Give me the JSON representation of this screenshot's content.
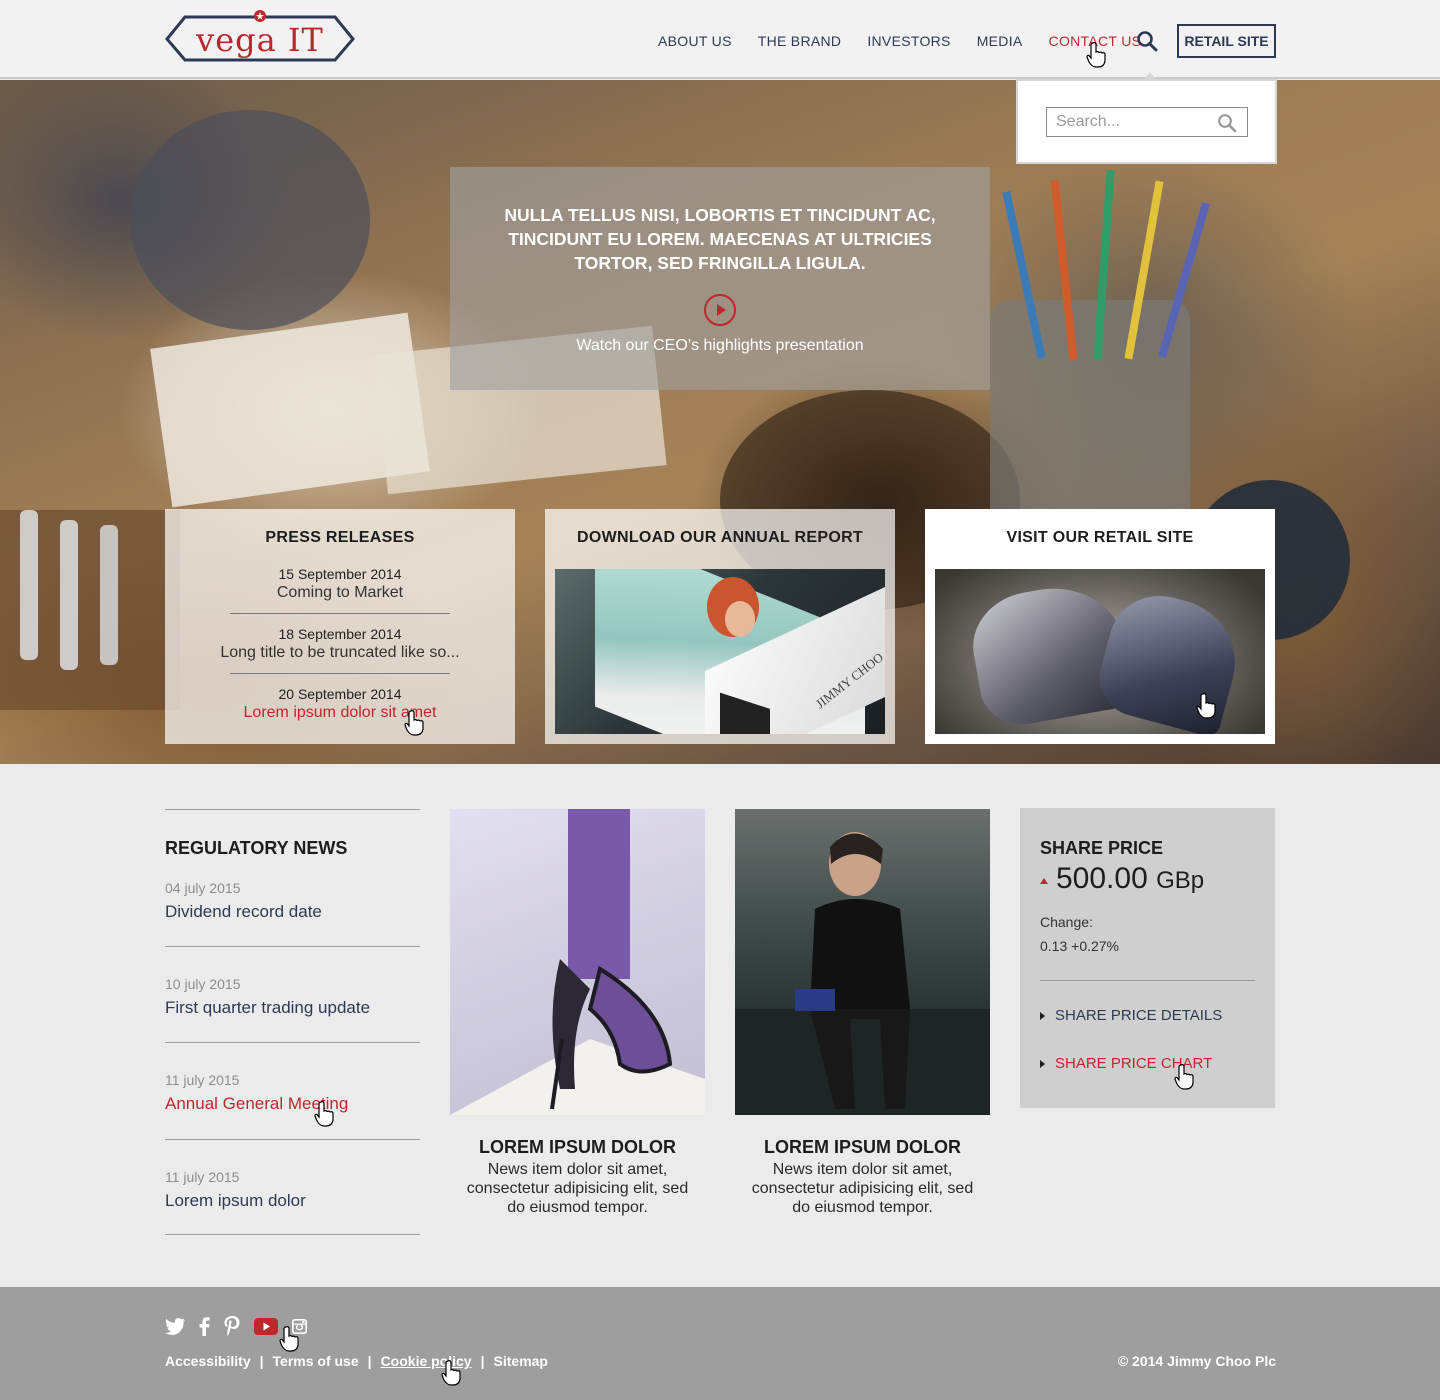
{
  "header": {
    "logo_text": "vega IT",
    "nav": [
      {
        "label": "ABOUT US",
        "active": false
      },
      {
        "label": "THE BRAND",
        "active": false
      },
      {
        "label": "INVESTORS",
        "active": false
      },
      {
        "label": "MEDIA",
        "active": false
      },
      {
        "label": "CONTACT US",
        "active": true
      }
    ],
    "search_icon": "search-icon",
    "retail_button": "RETAIL SITE"
  },
  "search_dropdown": {
    "placeholder": "Search..."
  },
  "hero": {
    "headline": "NULLA TELLUS NISI, LOBORTIS ET TINCIDUNT AC, TINCIDUNT EU LOREM. MAECENAS AT ULTRICIES TORTOR, SED FRINGILLA LIGULA.",
    "play_icon": "play-icon",
    "caption": "Watch our CEO’s highlights presentation"
  },
  "cards": {
    "press": {
      "title": "PRESS RELEASES",
      "items": [
        {
          "date": "15 September 2014",
          "title": "Coming to Market"
        },
        {
          "date": "18 September 2014",
          "title": "Long title to be truncated like so..."
        },
        {
          "date": "20 September 2014",
          "title": "Lorem ipsum dolor sit amet"
        }
      ]
    },
    "annual": {
      "title": "DOWNLOAD OUR ANNUAL REPORT",
      "image_text": "JIMMY CHOO"
    },
    "retail": {
      "title": "VISIT OUR RETAIL SITE"
    }
  },
  "regulatory": {
    "title": "REGULATORY NEWS",
    "items": [
      {
        "date": "04 july 2015",
        "title": "Dividend record date"
      },
      {
        "date": "10 july 2015",
        "title": "First quarter trading update"
      },
      {
        "date": "11 july 2015",
        "title": "Annual General Meeting"
      },
      {
        "date": "11 july 2015",
        "title": "Lorem ipsum dolor"
      }
    ]
  },
  "news": [
    {
      "title": "LOREM IPSUM DOLOR",
      "text": "News item dolor sit amet, consectetur adipisicing elit, sed do eiusmod tempor."
    },
    {
      "title": "LOREM IPSUM DOLOR",
      "text": "News item dolor sit amet, consectetur adipisicing elit, sed do eiusmod tempor."
    }
  ],
  "share": {
    "title": "SHARE PRICE",
    "value": "500.00",
    "unit": "GBp",
    "change_label": "Change:",
    "change_value": "0.13  +0.27%",
    "links": [
      "SHARE PRICE DETAILS",
      "SHARE PRICE CHART"
    ]
  },
  "footer": {
    "social": [
      "twitter-icon",
      "facebook-icon",
      "pinterest-icon",
      "youtube-icon",
      "instagram-icon"
    ],
    "links": [
      "Accessibility",
      "Terms of use",
      "Cookie policy",
      "Sitemap"
    ],
    "separator": "|",
    "copyright": "© 2014 Jimmy Choo Plc"
  },
  "colors": {
    "accent_red": "#c0272d",
    "navy": "#2c3a55",
    "footer_bg": "#9e9e9e"
  }
}
